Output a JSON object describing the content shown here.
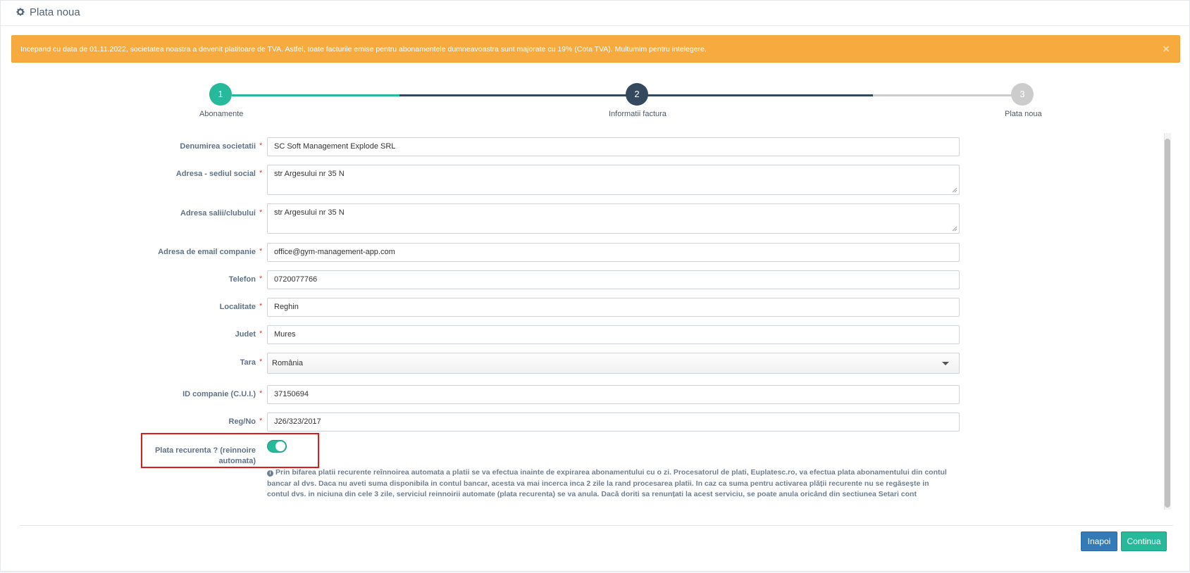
{
  "header": {
    "title": "Plata noua",
    "icon": "gear-icon"
  },
  "alert": {
    "message": "Incepand cu data de 01.11.2022, societatea noastra a devenit platitoare de TVA. Astfel, toate facturile emise pentru abonamentele dumneavoastra sunt majorate cu 19% (Cota TVA). Multumim pentru intelegere.",
    "close": "×",
    "color": "#f7ab3e"
  },
  "steps": [
    {
      "number": "1",
      "label": "Abonamente",
      "state": "done",
      "color": "#26b99a"
    },
    {
      "number": "2",
      "label": "Informatii factura",
      "state": "active",
      "color": "#34495e"
    },
    {
      "number": "3",
      "label": "Plata noua",
      "state": "pending",
      "color": "#cccccc"
    }
  ],
  "form": {
    "required_mark": "*",
    "company_name": {
      "label": "Denumirea societatii",
      "value": "SC Soft Management Explode SRL"
    },
    "headquarters": {
      "label": "Adresa - sediul social",
      "value": "str Argesului nr 35 N"
    },
    "club_address": {
      "label": "Adresa salii/clubului",
      "value": "str Argesului nr 35 N"
    },
    "email": {
      "label": "Adresa de email companie",
      "value": "office@gym-management-app.com"
    },
    "phone": {
      "label": "Telefon",
      "value": "0720077766"
    },
    "city": {
      "label": "Localitate",
      "value": "Reghin"
    },
    "county": {
      "label": "Judet",
      "value": "Mures"
    },
    "country": {
      "label": "Tara",
      "value": "România"
    },
    "company_id": {
      "label": "ID companie (C.U.I.)",
      "value": "37150694"
    },
    "reg_no": {
      "label": "Reg/No",
      "value": "J26/323/2017"
    },
    "recurring": {
      "label_line1": "Plata recurenta ? (reinnoire",
      "label_line2": "automata)",
      "enabled": true,
      "info_icon": "i",
      "info": "Prin bifarea platii recurente reînnoirea automata a platii se va efectua inainte de expirarea abonamentului cu o zi. Procesatorul de plati, Euplatesc.ro, va efectua plata abonamentului din contul bancar al dvs. Daca nu aveti suma disponibila in contul bancar, acesta va mai incerca inca 2 zile la rand procesarea platii. In caz ca suma pentru activarea plății recurente nu se regăsește in contul dvs. in niciuna din cele 3 zile, serviciul reinnoirii automate (plata recurenta) se va anula. Dacă doriti sa renunțati la acest serviciu, se poate anula oricând din sectiunea Setari cont"
    }
  },
  "buttons": {
    "back": "Inapoi",
    "next": "Continua"
  }
}
